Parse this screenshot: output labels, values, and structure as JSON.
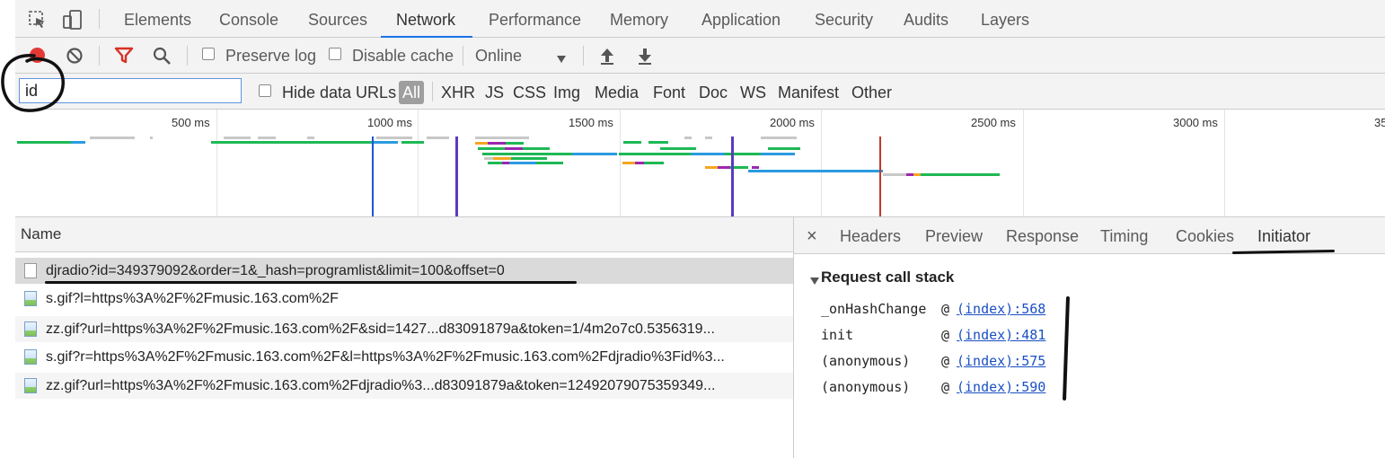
{
  "tabs": [
    "Elements",
    "Console",
    "Sources",
    "Network",
    "Performance",
    "Memory",
    "Application",
    "Security",
    "Audits",
    "Layers"
  ],
  "active_tab": "Network",
  "toolbar": {
    "preserve_log": "Preserve log",
    "disable_cache": "Disable cache",
    "throttling": "Online"
  },
  "filter": {
    "value": "id",
    "hide_data_urls": "Hide data URLs",
    "types": [
      "All",
      "XHR",
      "JS",
      "CSS",
      "Img",
      "Media",
      "Font",
      "Doc",
      "WS",
      "Manifest",
      "Other"
    ]
  },
  "timeline": {
    "ticks": [
      "500 ms",
      "1000 ms",
      "1500 ms",
      "2000 ms",
      "2500 ms",
      "3000 ms",
      "35"
    ]
  },
  "requests": {
    "column_name": "Name",
    "rows": [
      "djradio?id=349379092&order=1&_hash=programlist&limit=100&offset=0",
      "s.gif?l=https%3A%2F%2Fmusic.163.com%2F",
      "zz.gif?url=https%3A%2F%2Fmusic.163.com%2F&sid=1427...d83091879a&token=1/4m2o7c0.5356319...",
      "s.gif?r=https%3A%2F%2Fmusic.163.com%2F&l=https%3A%2F%2Fmusic.163.com%2Fdjradio%3Fid%3...",
      "zz.gif?url=https%3A%2F%2Fmusic.163.com%2Fdjradio%3...d83091879a&token=12492079075359349..."
    ]
  },
  "details": {
    "close": "×",
    "tabs": [
      "Headers",
      "Preview",
      "Response",
      "Timing",
      "Cookies",
      "Initiator"
    ],
    "active_tab": "Initiator",
    "call_stack_title": "Request call stack",
    "call_stack": [
      {
        "func": "_onHashChange",
        "at": "@",
        "loc": "(index):568"
      },
      {
        "func": "init",
        "at": "@",
        "loc": "(index):481"
      },
      {
        "func": "(anonymous)",
        "at": "@",
        "loc": "(index):575"
      },
      {
        "func": "(anonymous)",
        "at": "@",
        "loc": "(index):590"
      }
    ]
  },
  "colors": {
    "record": "#e53935",
    "filter_icon": "#d93025",
    "active_tab_underline": "#1a73e8",
    "link": "#1a4fc4",
    "selected_row": "#dadada"
  }
}
